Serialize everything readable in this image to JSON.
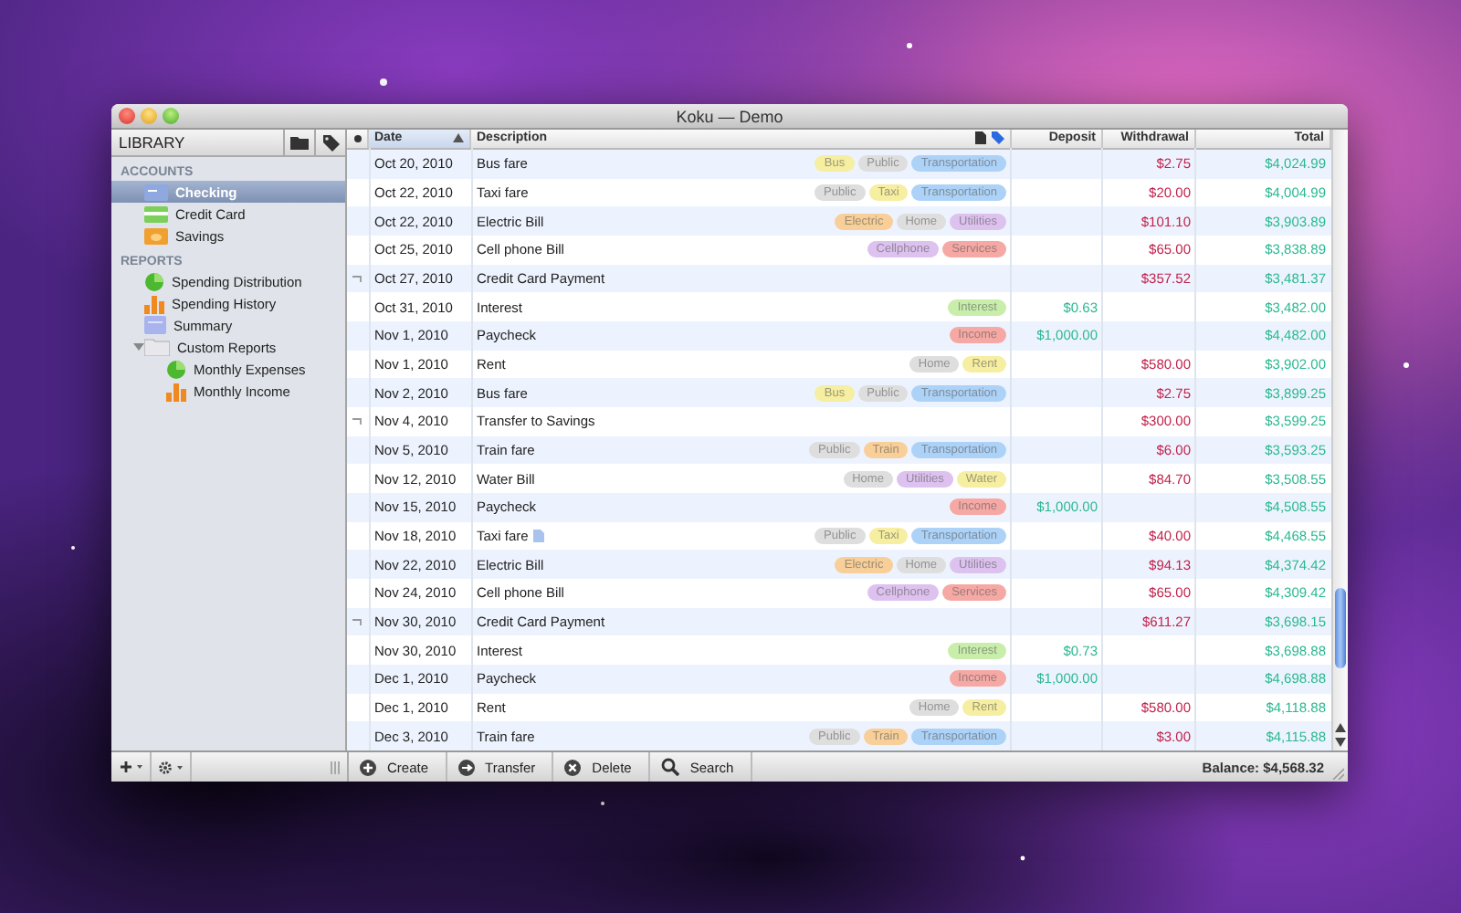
{
  "window": {
    "title": "Koku — Demo"
  },
  "sidebar": {
    "title": "LIBRARY",
    "sections": [
      {
        "heading": "ACCOUNTS",
        "items": [
          {
            "label": "Checking",
            "kind": "checking",
            "selected": true
          },
          {
            "label": "Credit Card",
            "kind": "card",
            "selected": false
          },
          {
            "label": "Savings",
            "kind": "savings",
            "selected": false
          }
        ]
      },
      {
        "heading": "REPORTS",
        "items": [
          {
            "label": "Spending Distribution",
            "kind": "pie",
            "selected": false
          },
          {
            "label": "Spending History",
            "kind": "bars",
            "selected": false
          },
          {
            "label": "Summary",
            "kind": "summary",
            "selected": false
          },
          {
            "label": "Custom Reports",
            "kind": "folder",
            "selected": false,
            "expanded": true,
            "children": [
              {
                "label": "Monthly Expenses",
                "kind": "pie",
                "selected": false
              },
              {
                "label": "Monthly Income",
                "kind": "bars",
                "selected": false
              }
            ]
          }
        ]
      }
    ]
  },
  "table": {
    "columns": [
      {
        "label": "Date",
        "sorted": true
      },
      {
        "label": "Description",
        "sorted": false
      },
      {
        "label": "Deposit",
        "sorted": false
      },
      {
        "label": "Withdrawal",
        "sorted": false
      },
      {
        "label": "Total",
        "sorted": false
      }
    ],
    "rows": [
      {
        "date": "Oct 20, 2010",
        "description": "Bus fare",
        "transfer": false,
        "note": false,
        "tags": [
          {
            "label": "Bus",
            "color": "#f6eea0"
          },
          {
            "label": "Public",
            "color": "#dedede"
          },
          {
            "label": "Transportation",
            "color": "#acd2f7"
          }
        ],
        "withdrawal": "$2.75",
        "total": "$4,024.99"
      },
      {
        "date": "Oct 22, 2010",
        "description": "Taxi fare",
        "transfer": false,
        "note": false,
        "tags": [
          {
            "label": "Public",
            "color": "#dedede"
          },
          {
            "label": "Taxi",
            "color": "#f6eea0"
          },
          {
            "label": "Transportation",
            "color": "#acd2f7"
          }
        ],
        "withdrawal": "$20.00",
        "total": "$4,004.99"
      },
      {
        "date": "Oct 22, 2010",
        "description": "Electric Bill",
        "transfer": false,
        "note": false,
        "tags": [
          {
            "label": "Electric",
            "color": "#f8cf98"
          },
          {
            "label": "Home",
            "color": "#dedede"
          },
          {
            "label": "Utilities",
            "color": "#ddc2ef"
          }
        ],
        "withdrawal": "$101.10",
        "total": "$3,903.89"
      },
      {
        "date": "Oct 25, 2010",
        "description": "Cell phone Bill",
        "transfer": false,
        "note": false,
        "tags": [
          {
            "label": "Cellphone",
            "color": "#ddc2ef"
          },
          {
            "label": "Services",
            "color": "#f6a9a4"
          }
        ],
        "withdrawal": "$65.00",
        "total": "$3,838.89"
      },
      {
        "date": "Oct 27, 2010",
        "description": "Credit Card Payment",
        "transfer": true,
        "note": false,
        "tags": [],
        "withdrawal": "$357.52",
        "total": "$3,481.37"
      },
      {
        "date": "Oct 31, 2010",
        "description": "Interest",
        "transfer": false,
        "note": false,
        "tags": [
          {
            "label": "Interest",
            "color": "#c9eeab"
          }
        ],
        "deposit": "$0.63",
        "total": "$3,482.00"
      },
      {
        "date": "Nov 1, 2010",
        "description": "Paycheck",
        "transfer": false,
        "note": false,
        "tags": [
          {
            "label": "Income",
            "color": "#f6a9a4"
          }
        ],
        "deposit": "$1,000.00",
        "total": "$4,482.00"
      },
      {
        "date": "Nov 1, 2010",
        "description": "Rent",
        "transfer": false,
        "note": false,
        "tags": [
          {
            "label": "Home",
            "color": "#dedede"
          },
          {
            "label": "Rent",
            "color": "#f6eea0"
          }
        ],
        "withdrawal": "$580.00",
        "total": "$3,902.00"
      },
      {
        "date": "Nov 2, 2010",
        "description": "Bus fare",
        "transfer": false,
        "note": false,
        "tags": [
          {
            "label": "Bus",
            "color": "#f6eea0"
          },
          {
            "label": "Public",
            "color": "#dedede"
          },
          {
            "label": "Transportation",
            "color": "#acd2f7"
          }
        ],
        "withdrawal": "$2.75",
        "total": "$3,899.25"
      },
      {
        "date": "Nov 4, 2010",
        "description": "Transfer to Savings",
        "transfer": true,
        "note": false,
        "tags": [],
        "withdrawal": "$300.00",
        "total": "$3,599.25"
      },
      {
        "date": "Nov 5, 2010",
        "description": "Train fare",
        "transfer": false,
        "note": false,
        "tags": [
          {
            "label": "Public",
            "color": "#dedede"
          },
          {
            "label": "Train",
            "color": "#f8cf98"
          },
          {
            "label": "Transportation",
            "color": "#acd2f7"
          }
        ],
        "withdrawal": "$6.00",
        "total": "$3,593.25"
      },
      {
        "date": "Nov 12, 2010",
        "description": "Water Bill",
        "transfer": false,
        "note": false,
        "tags": [
          {
            "label": "Home",
            "color": "#dedede"
          },
          {
            "label": "Utilities",
            "color": "#ddc2ef"
          },
          {
            "label": "Water",
            "color": "#f6eea0"
          }
        ],
        "withdrawal": "$84.70",
        "total": "$3,508.55"
      },
      {
        "date": "Nov 15, 2010",
        "description": "Paycheck",
        "transfer": false,
        "note": false,
        "tags": [
          {
            "label": "Income",
            "color": "#f6a9a4"
          }
        ],
        "deposit": "$1,000.00",
        "total": "$4,508.55"
      },
      {
        "date": "Nov 18, 2010",
        "description": "Taxi fare",
        "transfer": false,
        "note": true,
        "tags": [
          {
            "label": "Public",
            "color": "#dedede"
          },
          {
            "label": "Taxi",
            "color": "#f6eea0"
          },
          {
            "label": "Transportation",
            "color": "#acd2f7"
          }
        ],
        "withdrawal": "$40.00",
        "total": "$4,468.55"
      },
      {
        "date": "Nov 22, 2010",
        "description": "Electric Bill",
        "transfer": false,
        "note": false,
        "tags": [
          {
            "label": "Electric",
            "color": "#f8cf98"
          },
          {
            "label": "Home",
            "color": "#dedede"
          },
          {
            "label": "Utilities",
            "color": "#ddc2ef"
          }
        ],
        "withdrawal": "$94.13",
        "total": "$4,374.42"
      },
      {
        "date": "Nov 24, 2010",
        "description": "Cell phone Bill",
        "transfer": false,
        "note": false,
        "tags": [
          {
            "label": "Cellphone",
            "color": "#ddc2ef"
          },
          {
            "label": "Services",
            "color": "#f6a9a4"
          }
        ],
        "withdrawal": "$65.00",
        "total": "$4,309.42"
      },
      {
        "date": "Nov 30, 2010",
        "description": "Credit Card Payment",
        "transfer": true,
        "note": false,
        "tags": [],
        "withdrawal": "$611.27",
        "total": "$3,698.15"
      },
      {
        "date": "Nov 30, 2010",
        "description": "Interest",
        "transfer": false,
        "note": false,
        "tags": [
          {
            "label": "Interest",
            "color": "#c9eeab"
          }
        ],
        "deposit": "$0.73",
        "total": "$3,698.88"
      },
      {
        "date": "Dec 1, 2010",
        "description": "Paycheck",
        "transfer": false,
        "note": false,
        "tags": [
          {
            "label": "Income",
            "color": "#f6a9a4"
          }
        ],
        "deposit": "$1,000.00",
        "total": "$4,698.88"
      },
      {
        "date": "Dec 1, 2010",
        "description": "Rent",
        "transfer": false,
        "note": false,
        "tags": [
          {
            "label": "Home",
            "color": "#dedede"
          },
          {
            "label": "Rent",
            "color": "#f6eea0"
          }
        ],
        "withdrawal": "$580.00",
        "total": "$4,118.88"
      },
      {
        "date": "Dec 3, 2010",
        "description": "Train fare",
        "transfer": false,
        "note": false,
        "tags": [
          {
            "label": "Public",
            "color": "#dedede"
          },
          {
            "label": "Train",
            "color": "#f8cf98"
          },
          {
            "label": "Transportation",
            "color": "#acd2f7"
          }
        ],
        "withdrawal": "$3.00",
        "total": "$4,115.88"
      }
    ]
  },
  "toolbar": [
    {
      "label": "Create",
      "kind": "plus"
    },
    {
      "label": "Transfer",
      "kind": "transfer"
    },
    {
      "label": "Delete",
      "kind": "delete"
    },
    {
      "label": "Search",
      "kind": "search"
    }
  ],
  "status": "Balance: $4,568.32"
}
